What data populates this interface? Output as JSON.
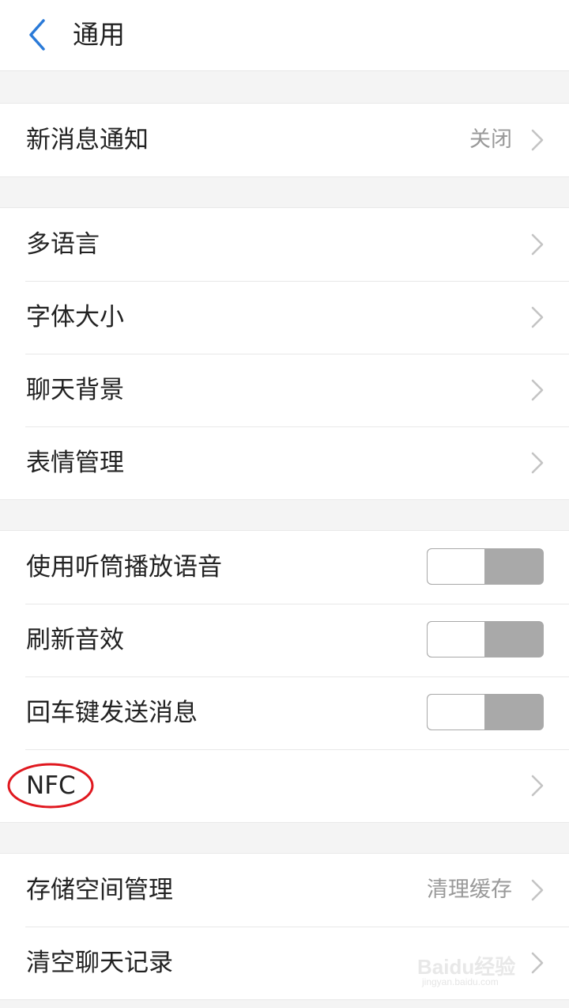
{
  "header": {
    "title": "通用"
  },
  "groups": [
    {
      "items": [
        {
          "label": "新消息通知",
          "value": "关闭"
        }
      ]
    },
    {
      "items": [
        {
          "label": "多语言"
        },
        {
          "label": "字体大小"
        },
        {
          "label": "聊天背景"
        },
        {
          "label": "表情管理"
        }
      ]
    },
    {
      "items": [
        {
          "label": "使用听筒播放语音",
          "toggle": "off"
        },
        {
          "label": "刷新音效",
          "toggle": "off"
        },
        {
          "label": "回车键发送消息",
          "toggle": "off"
        },
        {
          "label": "NFC"
        }
      ]
    },
    {
      "items": [
        {
          "label": "存储空间管理",
          "value": "清理缓存"
        },
        {
          "label": "清空聊天记录"
        }
      ]
    }
  ],
  "annotation": {
    "color": "#e0181f"
  },
  "watermark": {
    "text": "Baidu经验",
    "sub": "jingyan.baidu.com"
  },
  "colors": {
    "accent": "#2a7ad8",
    "toggle_off_track": "#a9a9a9"
  }
}
